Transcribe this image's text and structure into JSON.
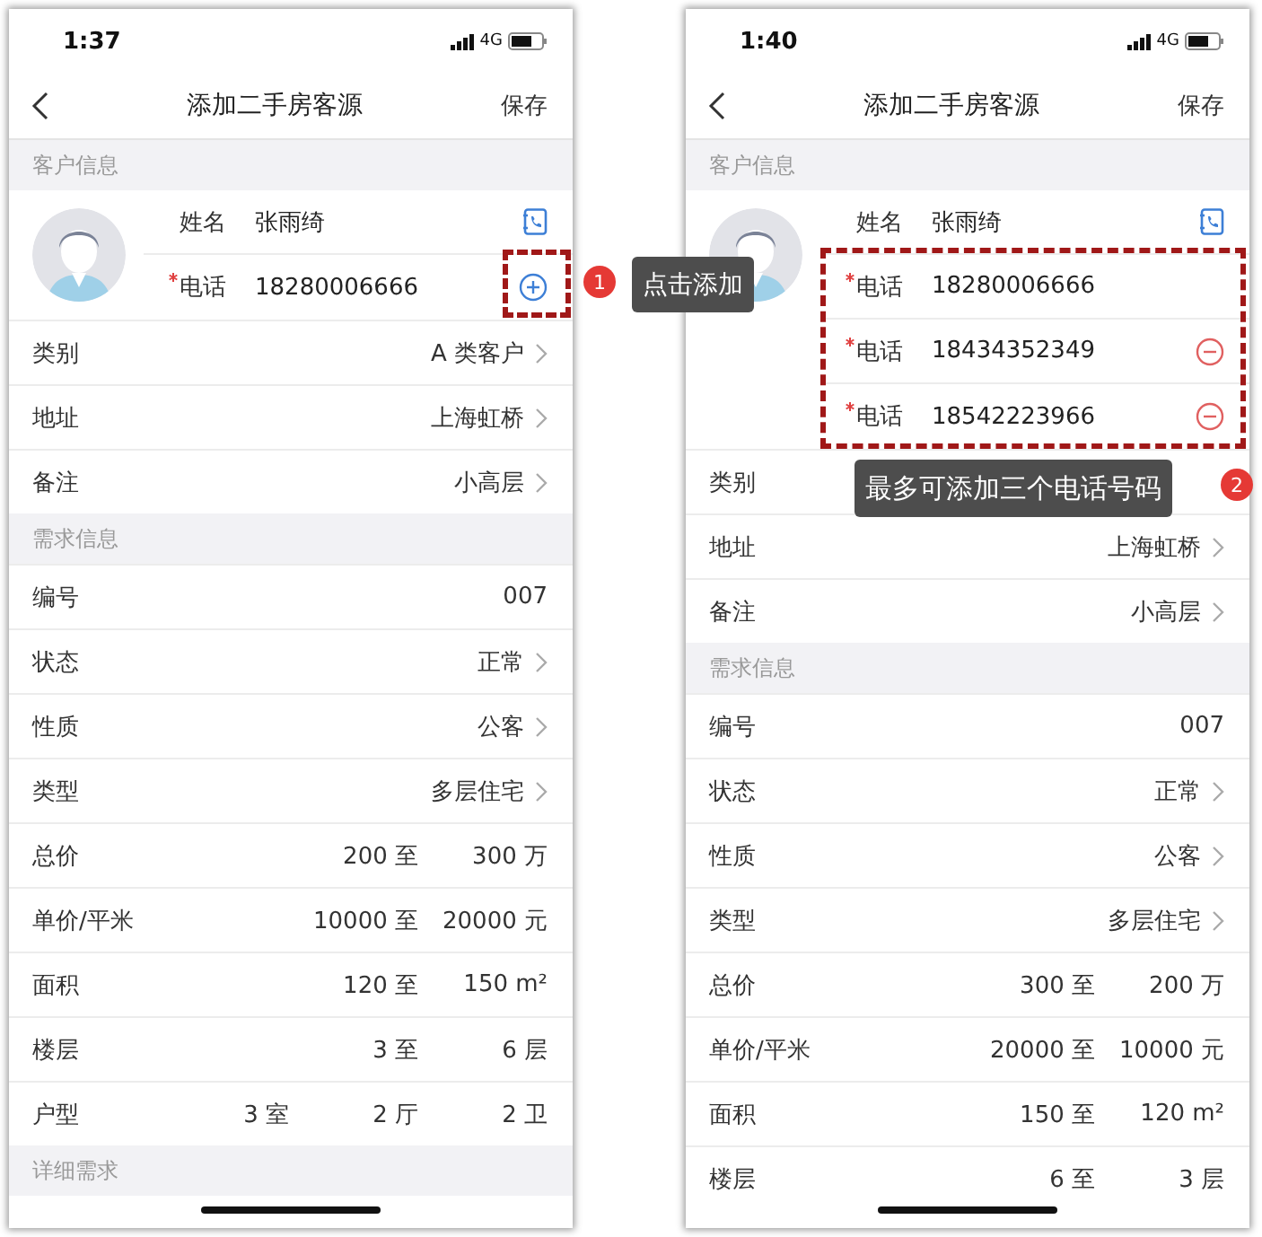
{
  "phones": [
    {
      "time": "1:37",
      "network": "4G",
      "title": "添加二手房客源",
      "save": "保存",
      "sections": [
        {
          "header": "客户信息",
          "customer": {
            "name_label": "姓名",
            "name": "张雨绮",
            "phones": [
              {
                "label": "电话",
                "required": true,
                "number": "18280006666",
                "kind": "add"
              }
            ]
          },
          "rows": [
            {
              "label": "类别",
              "kind": "nav",
              "value": "A 类客户"
            },
            {
              "label": "地址",
              "kind": "nav",
              "value": "上海虹桥"
            },
            {
              "label": "备注",
              "kind": "nav",
              "value": "小高层"
            }
          ]
        },
        {
          "header": "需求信息",
          "rows": [
            {
              "label": "编号",
              "kind": "value",
              "value": "007"
            },
            {
              "label": "状态",
              "kind": "nav",
              "value": "正常"
            },
            {
              "label": "性质",
              "kind": "nav",
              "value": "公客"
            },
            {
              "label": "类型",
              "kind": "nav",
              "value": "多层住宅"
            },
            {
              "label": "总价",
              "kind": "range",
              "parts": [
                "200 至",
                "300 万"
              ]
            },
            {
              "label": "单价/平米",
              "kind": "range",
              "parts": [
                "10000 至",
                "20000 元"
              ]
            },
            {
              "label": "面积",
              "kind": "range",
              "parts": [
                "120 至",
                "150 m²"
              ]
            },
            {
              "label": "楼层",
              "kind": "range",
              "parts": [
                "3 至",
                "6 层"
              ]
            },
            {
              "label": "户型",
              "kind": "range",
              "parts": [
                "3 室",
                "2 厅",
                "2 卫"
              ]
            }
          ]
        },
        {
          "header": "详细需求"
        }
      ]
    },
    {
      "time": "1:40",
      "network": "4G",
      "title": "添加二手房客源",
      "save": "保存",
      "sections": [
        {
          "header": "客户信息",
          "customer": {
            "name_label": "姓名",
            "name": "张雨绮",
            "phones": [
              {
                "label": "电话",
                "required": true,
                "number": "18280006666",
                "kind": "plain"
              },
              {
                "label": "电话",
                "required": true,
                "number": "18434352349",
                "kind": "remove"
              },
              {
                "label": "电话",
                "required": true,
                "number": "18542223966",
                "kind": "remove"
              }
            ]
          },
          "rows": [
            {
              "label": "类别",
              "kind": "value"
            },
            {
              "label": "地址",
              "kind": "nav",
              "value": "上海虹桥"
            },
            {
              "label": "备注",
              "kind": "nav",
              "value": "小高层"
            }
          ]
        },
        {
          "header": "需求信息",
          "rows": [
            {
              "label": "编号",
              "kind": "value",
              "value": "007"
            },
            {
              "label": "状态",
              "kind": "nav",
              "value": "正常"
            },
            {
              "label": "性质",
              "kind": "nav",
              "value": "公客"
            },
            {
              "label": "类型",
              "kind": "nav",
              "value": "多层住宅"
            },
            {
              "label": "总价",
              "kind": "range",
              "parts": [
                "300 至",
                "200 万"
              ]
            },
            {
              "label": "单价/平米",
              "kind": "range",
              "parts": [
                "20000 至",
                "10000 元"
              ]
            },
            {
              "label": "面积",
              "kind": "range",
              "parts": [
                "150 至",
                "120 m²"
              ]
            },
            {
              "label": "楼层",
              "kind": "range",
              "parts": [
                "6 至",
                "3 层"
              ]
            }
          ]
        }
      ]
    }
  ],
  "annotations": [
    {
      "number": "1",
      "text": "点击添加"
    },
    {
      "number": "2",
      "text": "最多可添加三个电话号码"
    }
  ]
}
